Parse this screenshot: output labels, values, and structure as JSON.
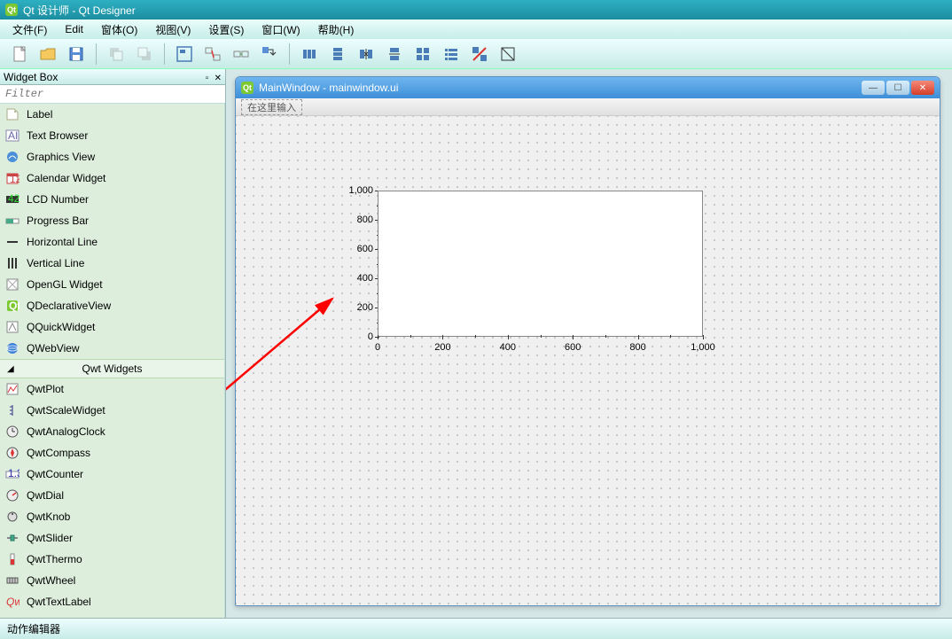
{
  "app": {
    "title": "Qt 设计师 - Qt Designer"
  },
  "menu": {
    "file": "文件(F)",
    "edit": "Edit",
    "form": "窗体(O)",
    "view": "视图(V)",
    "settings": "设置(S)",
    "window": "窗口(W)",
    "help": "帮助(H)"
  },
  "widgetbox": {
    "title": "Widget Box",
    "filter_placeholder": "Filter",
    "display_widgets": [
      {
        "icon": "label-icon",
        "label": "Label"
      },
      {
        "icon": "textbrowser-icon",
        "label": "Text Browser"
      },
      {
        "icon": "graphicsview-icon",
        "label": "Graphics View"
      },
      {
        "icon": "calendar-icon",
        "label": "Calendar Widget"
      },
      {
        "icon": "lcd-icon",
        "label": "LCD Number"
      },
      {
        "icon": "progressbar-icon",
        "label": "Progress Bar"
      },
      {
        "icon": "hline-icon",
        "label": "Horizontal Line"
      },
      {
        "icon": "vline-icon",
        "label": "Vertical Line"
      },
      {
        "icon": "opengl-icon",
        "label": "OpenGL Widget"
      },
      {
        "icon": "qdeclarative-icon",
        "label": "QDeclarativeView"
      },
      {
        "icon": "qquick-icon",
        "label": "QQuickWidget"
      },
      {
        "icon": "qwebview-icon",
        "label": "QWebView"
      }
    ],
    "qwt_category": "Qwt Widgets",
    "qwt_widgets": [
      {
        "icon": "qwtplot-icon",
        "label": "QwtPlot"
      },
      {
        "icon": "qwtscale-icon",
        "label": "QwtScaleWidget"
      },
      {
        "icon": "qwtclock-icon",
        "label": "QwtAnalogClock"
      },
      {
        "icon": "qwtcompass-icon",
        "label": "QwtCompass"
      },
      {
        "icon": "qwtcounter-icon",
        "label": "QwtCounter"
      },
      {
        "icon": "qwtdial-icon",
        "label": "QwtDial"
      },
      {
        "icon": "qwtknob-icon",
        "label": "QwtKnob"
      },
      {
        "icon": "qwtslider-icon",
        "label": "QwtSlider"
      },
      {
        "icon": "qwtthermo-icon",
        "label": "QwtThermo"
      },
      {
        "icon": "qwtwheel-icon",
        "label": "QwtWheel"
      },
      {
        "icon": "qwttextlabel-icon",
        "label": "QwtTextLabel"
      }
    ]
  },
  "mdi": {
    "title": "MainWindow - mainwindow.ui",
    "menu_hint": "在这里输入"
  },
  "footer": {
    "label": "动作编辑器"
  },
  "chart_data": {
    "type": "scatter",
    "title": "",
    "xlabel": "",
    "ylabel": "",
    "x_ticks": [
      0,
      200,
      400,
      600,
      800,
      1000
    ],
    "y_ticks": [
      0,
      200,
      400,
      600,
      800,
      1000
    ],
    "x_tick_labels": [
      "0",
      "200",
      "400",
      "600",
      "800",
      "1,000"
    ],
    "y_tick_labels": [
      "0",
      "200",
      "400",
      "600",
      "800",
      "1,000"
    ],
    "xlim": [
      0,
      1000
    ],
    "ylim": [
      0,
      1000
    ],
    "series": []
  },
  "annotation": {
    "arrow_color": "#ff0000"
  }
}
